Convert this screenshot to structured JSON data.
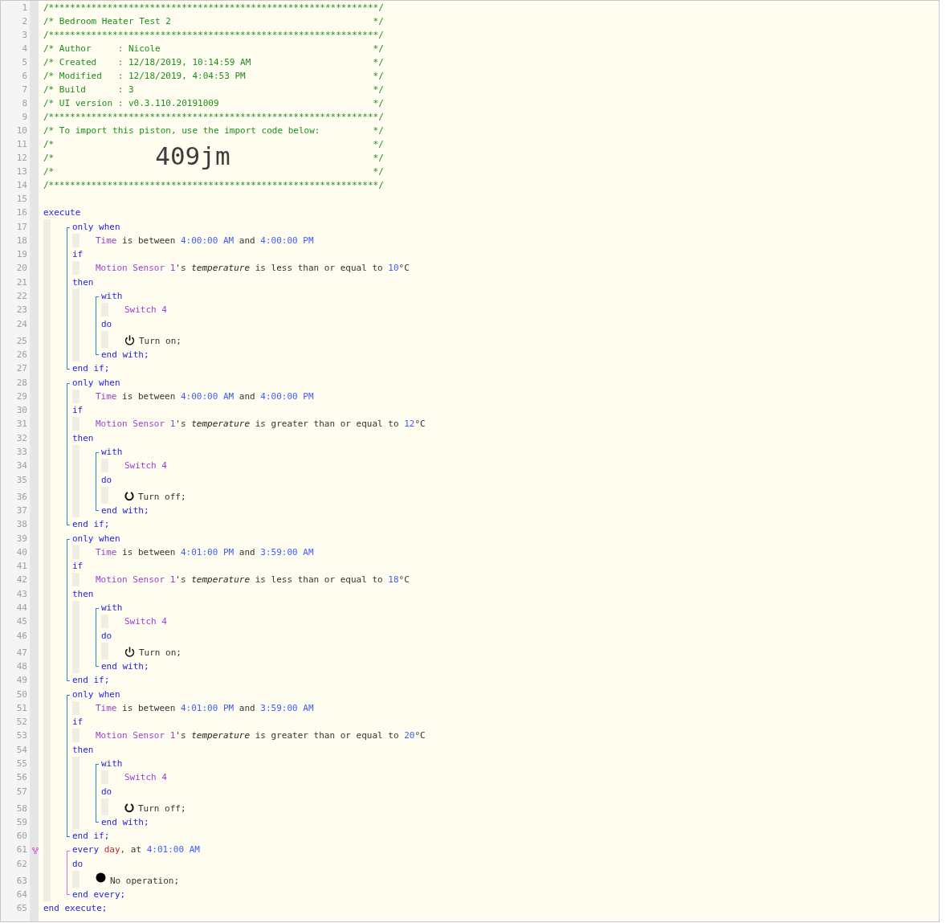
{
  "header": [
    {
      "number": "1",
      "text": "/**************************************************************/"
    },
    {
      "number": "2",
      "text": "/* Bedroom Heater Test 2",
      "end": "*/"
    },
    {
      "number": "3",
      "text": "/**************************************************************/"
    },
    {
      "number": "4",
      "text": "/* Author     : Nicole",
      "end": "*/"
    },
    {
      "number": "5",
      "text": "/* Created    : 12/18/2019, 10:14:59 AM",
      "end": "*/"
    },
    {
      "number": "6",
      "text": "/* Modified   : 12/18/2019, 4:04:53 PM",
      "end": "*/"
    },
    {
      "number": "7",
      "text": "/* Build      : 3",
      "end": "*/"
    },
    {
      "number": "8",
      "text": "/* UI version : v0.3.110.20191009",
      "end": "*/"
    },
    {
      "number": "9",
      "text": "/**************************************************************/"
    },
    {
      "number": "10",
      "text": "/* To import this piston, use the import code below:",
      "end": "*/"
    },
    {
      "number": "11",
      "text": "/*",
      "end": "*/"
    },
    {
      "number": "12",
      "text": "/*",
      "code": "409jm",
      "end": "*/"
    },
    {
      "number": "13",
      "text": "/*",
      "end": "*/"
    },
    {
      "number": "14",
      "text": "/**************************************************************/"
    },
    {
      "number": "15"
    }
  ],
  "program": {
    "number": "16",
    "tokens": [
      {
        "text": "execute",
        "kind": "keyword"
      }
    ],
    "body": [
      {
        "kind": "block",
        "color": "#1e88e5",
        "sections": [
          {
            "number": "17",
            "tokens": [
              {
                "text": "only when",
                "kind": "keyword"
              }
            ],
            "body": [
              {
                "kind": "row",
                "number": "18",
                "tokens": [
                  {
                    "text": "Time",
                    "kind": "device"
                  },
                  {
                    "text": " is between ",
                    "kind": "plain"
                  },
                  {
                    "text": "4:00:00 AM",
                    "kind": "value"
                  },
                  {
                    "text": " and ",
                    "kind": "plain"
                  },
                  {
                    "text": "4:00:00 PM",
                    "kind": "value"
                  }
                ]
              }
            ]
          },
          {
            "number": "19",
            "tokens": [
              {
                "text": "if",
                "kind": "keyword"
              }
            ],
            "body": [
              {
                "kind": "row",
                "number": "20",
                "tokens": [
                  {
                    "text": "Motion Sensor 1",
                    "kind": "device"
                  },
                  {
                    "text": "'s ",
                    "kind": "plain"
                  },
                  {
                    "text": "temperature",
                    "kind": "attribute"
                  },
                  {
                    "text": " is less than or equal to ",
                    "kind": "plain"
                  },
                  {
                    "text": "10",
                    "kind": "value"
                  },
                  {
                    "text": "°C",
                    "kind": "plain"
                  }
                ]
              }
            ]
          },
          {
            "number": "21",
            "tokens": [
              {
                "text": "then",
                "kind": "keyword"
              }
            ],
            "body": [
              {
                "kind": "block",
                "color": "#1e88e5",
                "sections": [
                  {
                    "number": "22",
                    "tokens": [
                      {
                        "text": "with",
                        "kind": "keyword"
                      }
                    ],
                    "body": [
                      {
                        "kind": "row",
                        "number": "23",
                        "tokens": [
                          {
                            "text": "Switch 4",
                            "kind": "device"
                          }
                        ]
                      }
                    ]
                  },
                  {
                    "number": "24",
                    "tokens": [
                      {
                        "text": "do",
                        "kind": "keyword"
                      }
                    ],
                    "body": [
                      {
                        "kind": "power",
                        "number": "25",
                        "tokens": [
                          {
                            "text": "Turn on;",
                            "kind": "plain"
                          }
                        ]
                      }
                    ]
                  }
                ],
                "end": {
                  "number": "26",
                  "tokens": [
                    {
                      "text": "end with;",
                      "kind": "keyword"
                    }
                  ]
                }
              }
            ]
          }
        ],
        "end": {
          "number": "27",
          "tokens": [
            {
              "text": "end if;",
              "kind": "keyword"
            }
          ]
        }
      },
      {
        "kind": "block",
        "color": "#1e88e5",
        "sections": [
          {
            "number": "28",
            "tokens": [
              {
                "text": "only when",
                "kind": "keyword"
              }
            ],
            "body": [
              {
                "kind": "row",
                "number": "29",
                "tokens": [
                  {
                    "text": "Time",
                    "kind": "device"
                  },
                  {
                    "text": " is between ",
                    "kind": "plain"
                  },
                  {
                    "text": "4:00:00 AM",
                    "kind": "value"
                  },
                  {
                    "text": " and ",
                    "kind": "plain"
                  },
                  {
                    "text": "4:00:00 PM",
                    "kind": "value"
                  }
                ]
              }
            ]
          },
          {
            "number": "30",
            "tokens": [
              {
                "text": "if",
                "kind": "keyword"
              }
            ],
            "body": [
              {
                "kind": "row",
                "number": "31",
                "tokens": [
                  {
                    "text": "Motion Sensor 1",
                    "kind": "device"
                  },
                  {
                    "text": "'s ",
                    "kind": "plain"
                  },
                  {
                    "text": "temperature",
                    "kind": "attribute"
                  },
                  {
                    "text": " is greater than or equal to ",
                    "kind": "plain"
                  },
                  {
                    "text": "12",
                    "kind": "value"
                  },
                  {
                    "text": "°C",
                    "kind": "plain"
                  }
                ]
              }
            ]
          },
          {
            "number": "32",
            "tokens": [
              {
                "text": "then",
                "kind": "keyword"
              }
            ],
            "body": [
              {
                "kind": "block",
                "color": "#1e88e5",
                "sections": [
                  {
                    "number": "33",
                    "tokens": [
                      {
                        "text": "with",
                        "kind": "keyword"
                      }
                    ],
                    "body": [
                      {
                        "kind": "row",
                        "number": "34",
                        "tokens": [
                          {
                            "text": "Switch 4",
                            "kind": "device"
                          }
                        ]
                      }
                    ]
                  },
                  {
                    "number": "35",
                    "tokens": [
                      {
                        "text": "do",
                        "kind": "keyword"
                      }
                    ],
                    "body": [
                      {
                        "kind": "ring",
                        "number": "36",
                        "tokens": [
                          {
                            "text": "Turn off;",
                            "kind": "plain"
                          }
                        ]
                      }
                    ]
                  }
                ],
                "end": {
                  "number": "37",
                  "tokens": [
                    {
                      "text": "end with;",
                      "kind": "keyword"
                    }
                  ]
                }
              }
            ]
          }
        ],
        "end": {
          "number": "38",
          "tokens": [
            {
              "text": "end if;",
              "kind": "keyword"
            }
          ]
        }
      },
      {
        "kind": "block",
        "color": "#1e88e5",
        "sections": [
          {
            "number": "39",
            "tokens": [
              {
                "text": "only when",
                "kind": "keyword"
              }
            ],
            "body": [
              {
                "kind": "row",
                "number": "40",
                "tokens": [
                  {
                    "text": "Time",
                    "kind": "device"
                  },
                  {
                    "text": " is between ",
                    "kind": "plain"
                  },
                  {
                    "text": "4:01:00 PM",
                    "kind": "value"
                  },
                  {
                    "text": " and ",
                    "kind": "plain"
                  },
                  {
                    "text": "3:59:00 AM",
                    "kind": "value"
                  }
                ]
              }
            ]
          },
          {
            "number": "41",
            "tokens": [
              {
                "text": "if",
                "kind": "keyword"
              }
            ],
            "body": [
              {
                "kind": "row",
                "number": "42",
                "tokens": [
                  {
                    "text": "Motion Sensor 1",
                    "kind": "device"
                  },
                  {
                    "text": "'s ",
                    "kind": "plain"
                  },
                  {
                    "text": "temperature",
                    "kind": "attribute"
                  },
                  {
                    "text": " is less than or equal to ",
                    "kind": "plain"
                  },
                  {
                    "text": "18",
                    "kind": "value"
                  },
                  {
                    "text": "°C",
                    "kind": "plain"
                  }
                ]
              }
            ]
          },
          {
            "number": "43",
            "tokens": [
              {
                "text": "then",
                "kind": "keyword"
              }
            ],
            "body": [
              {
                "kind": "block",
                "color": "#1e88e5",
                "sections": [
                  {
                    "number": "44",
                    "tokens": [
                      {
                        "text": "with",
                        "kind": "keyword"
                      }
                    ],
                    "body": [
                      {
                        "kind": "row",
                        "number": "45",
                        "tokens": [
                          {
                            "text": "Switch 4",
                            "kind": "device"
                          }
                        ]
                      }
                    ]
                  },
                  {
                    "number": "46",
                    "tokens": [
                      {
                        "text": "do",
                        "kind": "keyword"
                      }
                    ],
                    "body": [
                      {
                        "kind": "power",
                        "number": "47",
                        "tokens": [
                          {
                            "text": "Turn on;",
                            "kind": "plain"
                          }
                        ]
                      }
                    ]
                  }
                ],
                "end": {
                  "number": "48",
                  "tokens": [
                    {
                      "text": "end with;",
                      "kind": "keyword"
                    }
                  ]
                }
              }
            ]
          }
        ],
        "end": {
          "number": "49",
          "tokens": [
            {
              "text": "end if;",
              "kind": "keyword"
            }
          ]
        }
      },
      {
        "kind": "block",
        "color": "#1e88e5",
        "sections": [
          {
            "number": "50",
            "tokens": [
              {
                "text": "only when",
                "kind": "keyword"
              }
            ],
            "body": [
              {
                "kind": "row",
                "number": "51",
                "tokens": [
                  {
                    "text": "Time",
                    "kind": "device"
                  },
                  {
                    "text": " is between ",
                    "kind": "plain"
                  },
                  {
                    "text": "4:01:00 PM",
                    "kind": "value"
                  },
                  {
                    "text": " and ",
                    "kind": "plain"
                  },
                  {
                    "text": "3:59:00 AM",
                    "kind": "value"
                  }
                ]
              }
            ]
          },
          {
            "number": "52",
            "tokens": [
              {
                "text": "if",
                "kind": "keyword"
              }
            ],
            "body": [
              {
                "kind": "row",
                "number": "53",
                "tokens": [
                  {
                    "text": "Motion Sensor 1",
                    "kind": "device"
                  },
                  {
                    "text": "'s ",
                    "kind": "plain"
                  },
                  {
                    "text": "temperature",
                    "kind": "attribute"
                  },
                  {
                    "text": " is greater than or equal to ",
                    "kind": "plain"
                  },
                  {
                    "text": "20",
                    "kind": "value"
                  },
                  {
                    "text": "°C",
                    "kind": "plain"
                  }
                ]
              }
            ]
          },
          {
            "number": "54",
            "tokens": [
              {
                "text": "then",
                "kind": "keyword"
              }
            ],
            "body": [
              {
                "kind": "block",
                "color": "#1e88e5",
                "sections": [
                  {
                    "number": "55",
                    "tokens": [
                      {
                        "text": "with",
                        "kind": "keyword"
                      }
                    ],
                    "body": [
                      {
                        "kind": "row",
                        "number": "56",
                        "tokens": [
                          {
                            "text": "Switch 4",
                            "kind": "device"
                          }
                        ]
                      }
                    ]
                  },
                  {
                    "number": "57",
                    "tokens": [
                      {
                        "text": "do",
                        "kind": "keyword"
                      }
                    ],
                    "body": [
                      {
                        "kind": "ring",
                        "number": "58",
                        "tokens": [
                          {
                            "text": "Turn off;",
                            "kind": "plain"
                          }
                        ]
                      }
                    ]
                  }
                ],
                "end": {
                  "number": "59",
                  "tokens": [
                    {
                      "text": "end with;",
                      "kind": "keyword"
                    }
                  ]
                }
              }
            ]
          }
        ],
        "end": {
          "number": "60",
          "tokens": [
            {
              "text": "end if;",
              "kind": "keyword"
            }
          ]
        }
      },
      {
        "kind": "block",
        "color": "#d36fd3",
        "sections": [
          {
            "number": "61",
            "flagged": true,
            "tokens": [
              {
                "text": "every ",
                "kind": "keyword"
              },
              {
                "text": "day,",
                "kind": "special"
              },
              {
                "text": " at ",
                "kind": "plain"
              },
              {
                "text": "4:01:00 AM",
                "kind": "value"
              }
            ]
          },
          {
            "number": "62",
            "tokens": [
              {
                "text": "do",
                "kind": "keyword"
              }
            ],
            "body": [
              {
                "kind": "dot",
                "number": "63",
                "tokens": [
                  {
                    "text": "No operation;",
                    "kind": "plain"
                  }
                ]
              }
            ]
          }
        ],
        "end": {
          "number": "64",
          "tokens": [
            {
              "text": "end every;",
              "kind": "keyword"
            }
          ]
        }
      }
    ],
    "end": {
      "number": "65",
      "tokens": [
        {
          "text": "end execute;",
          "kind": "keyword"
        }
      ]
    }
  }
}
